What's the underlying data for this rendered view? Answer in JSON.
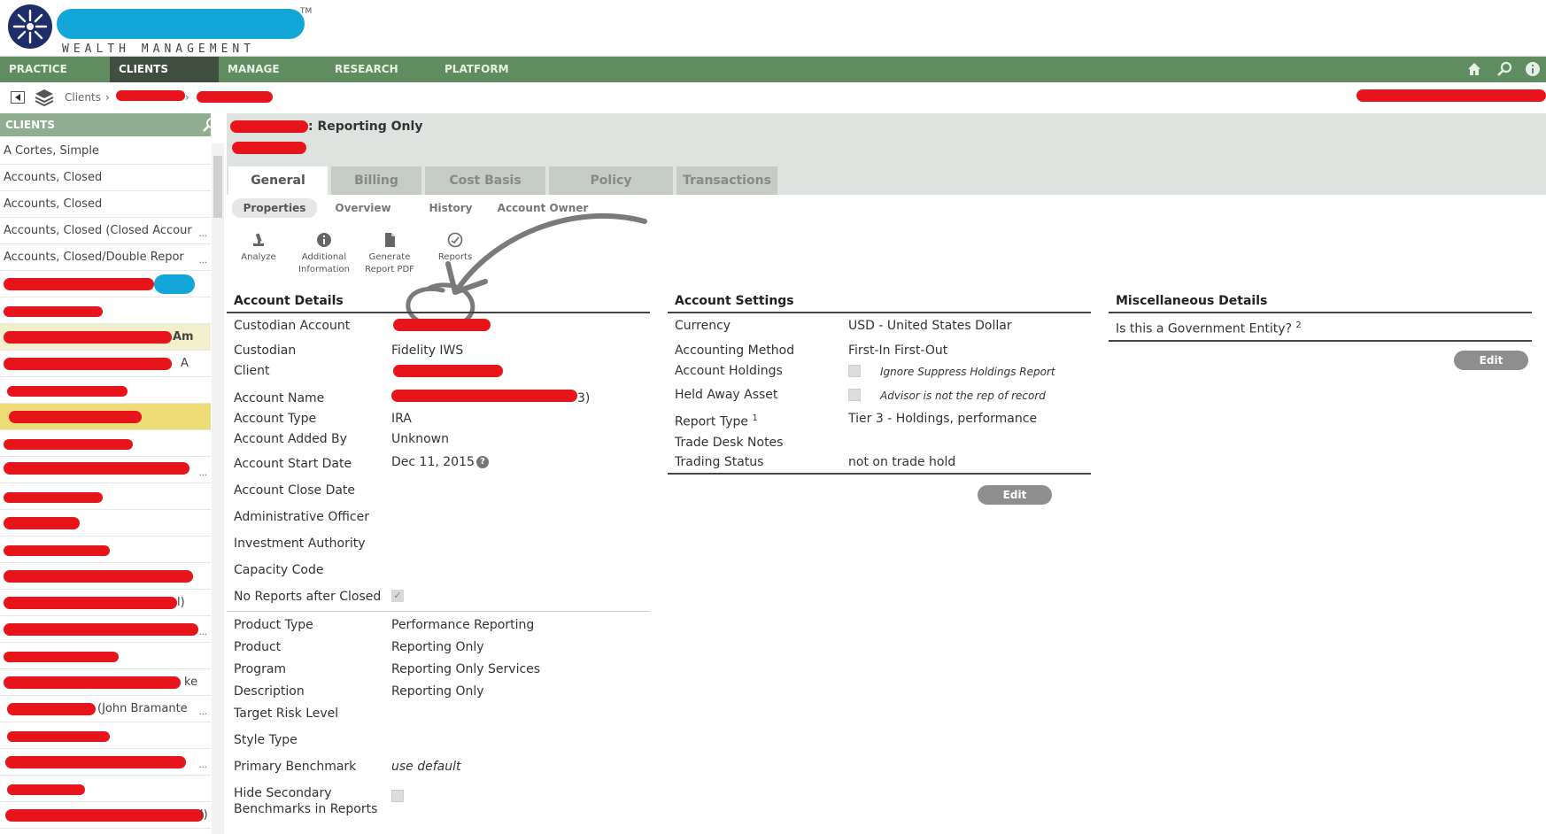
{
  "app": {
    "brand_suffix": "WEALTH MANAGEMENT",
    "trademark": "TM"
  },
  "nav": {
    "items": [
      {
        "label": "PRACTICE"
      },
      {
        "label": "CLIENTS",
        "active": true
      },
      {
        "label": "MANAGE"
      },
      {
        "label": "RESEARCH"
      },
      {
        "label": "PLATFORM"
      }
    ],
    "icons": [
      "home-icon",
      "search-icon",
      "info-icon"
    ]
  },
  "breadcrumb": {
    "items": [
      "Clients"
    ]
  },
  "sidebar": {
    "header": "CLIENTS",
    "rows": [
      "A Cortes, Simple",
      "Accounts, Closed",
      "Accounts, Closed",
      "Accounts, Closed (Closed Accour",
      "Accounts, Closed/Double Repor",
      "",
      "",
      "",
      "",
      "",
      "",
      "",
      "",
      "",
      "",
      "",
      "",
      "",
      "",
      "",
      "",
      "",
      "",
      "",
      ""
    ],
    "row_fragments": {
      "r7": "Am",
      "r8": "A",
      "r14": "l)",
      "r17": "ke",
      "r18": "(John Bramante",
      "r21": "l)"
    }
  },
  "account": {
    "title_suffix": ": Reporting Only"
  },
  "tabs": [
    {
      "label": "General",
      "active": true
    },
    {
      "label": "Billing"
    },
    {
      "label": "Cost Basis"
    },
    {
      "label": "Policy"
    },
    {
      "label": "Transactions"
    }
  ],
  "subtabs": [
    {
      "label": "Properties",
      "active": true
    },
    {
      "label": "Overview"
    },
    {
      "label": "History"
    },
    {
      "label": "Account Owner"
    }
  ],
  "tools": [
    {
      "icon": "analyze-icon",
      "label_1": "Analyze",
      "label_2": ""
    },
    {
      "icon": "info-icon",
      "label_1": "Additional",
      "label_2": "Information"
    },
    {
      "icon": "pdf-icon",
      "label_1": "Generate",
      "label_2": "Report PDF"
    },
    {
      "icon": "reports-icon",
      "label_1": "Reports",
      "label_2": ""
    }
  ],
  "account_details": {
    "title": "Account Details",
    "fields": [
      {
        "label": "Custodian Account",
        "value": ""
      },
      {
        "label": "Custodian",
        "value": "Fidelity IWS"
      },
      {
        "label": "Client",
        "value": ""
      },
      {
        "label": "Account Name",
        "value": "3)"
      },
      {
        "label": "Account Type",
        "value": "IRA"
      },
      {
        "label": "Account Added By",
        "value": "Unknown"
      },
      {
        "label": "Account Start Date",
        "value": "Dec 11, 2015"
      },
      {
        "label": "Account Close Date",
        "value": ""
      },
      {
        "label": "Administrative Officer",
        "value": ""
      },
      {
        "label": "Investment Authority",
        "value": ""
      },
      {
        "label": "Capacity Code",
        "value": ""
      },
      {
        "label": "No Reports after Closed",
        "value": ""
      },
      {
        "label": "Product Type",
        "value": "Performance Reporting"
      },
      {
        "label": "Product",
        "value": "Reporting Only"
      },
      {
        "label": "Program",
        "value": "Reporting Only Services"
      },
      {
        "label": "Description",
        "value": "Reporting Only"
      },
      {
        "label": "Target Risk Level",
        "value": ""
      },
      {
        "label": "Style Type",
        "value": ""
      },
      {
        "label": "Primary Benchmark",
        "value": "use default"
      },
      {
        "label": "Hide Secondary",
        "value": ""
      },
      {
        "label": "Benchmarks in Reports",
        "value": ""
      }
    ]
  },
  "account_settings": {
    "title": "Account Settings",
    "fields": [
      {
        "label": "Currency",
        "value": "USD - United States Dollar"
      },
      {
        "label": "Accounting Method",
        "value": "First-In First-Out"
      },
      {
        "label": "Account Holdings",
        "value": "Ignore Suppress Holdings Report"
      },
      {
        "label": "Held Away Asset",
        "value": "Advisor is not the rep of record"
      },
      {
        "label": "Report Type",
        "sup": "1",
        "value": "Tier 3 - Holdings, performance"
      },
      {
        "label": "Trade Desk Notes",
        "value": ""
      },
      {
        "label": "Trading Status",
        "value": "not on trade hold"
      }
    ],
    "edit_label": "Edit"
  },
  "misc_details": {
    "title": "Miscellaneous Details",
    "fields": [
      {
        "label": "Is this a Government Entity?",
        "sup": "2",
        "value": ""
      }
    ],
    "edit_label": "Edit"
  }
}
